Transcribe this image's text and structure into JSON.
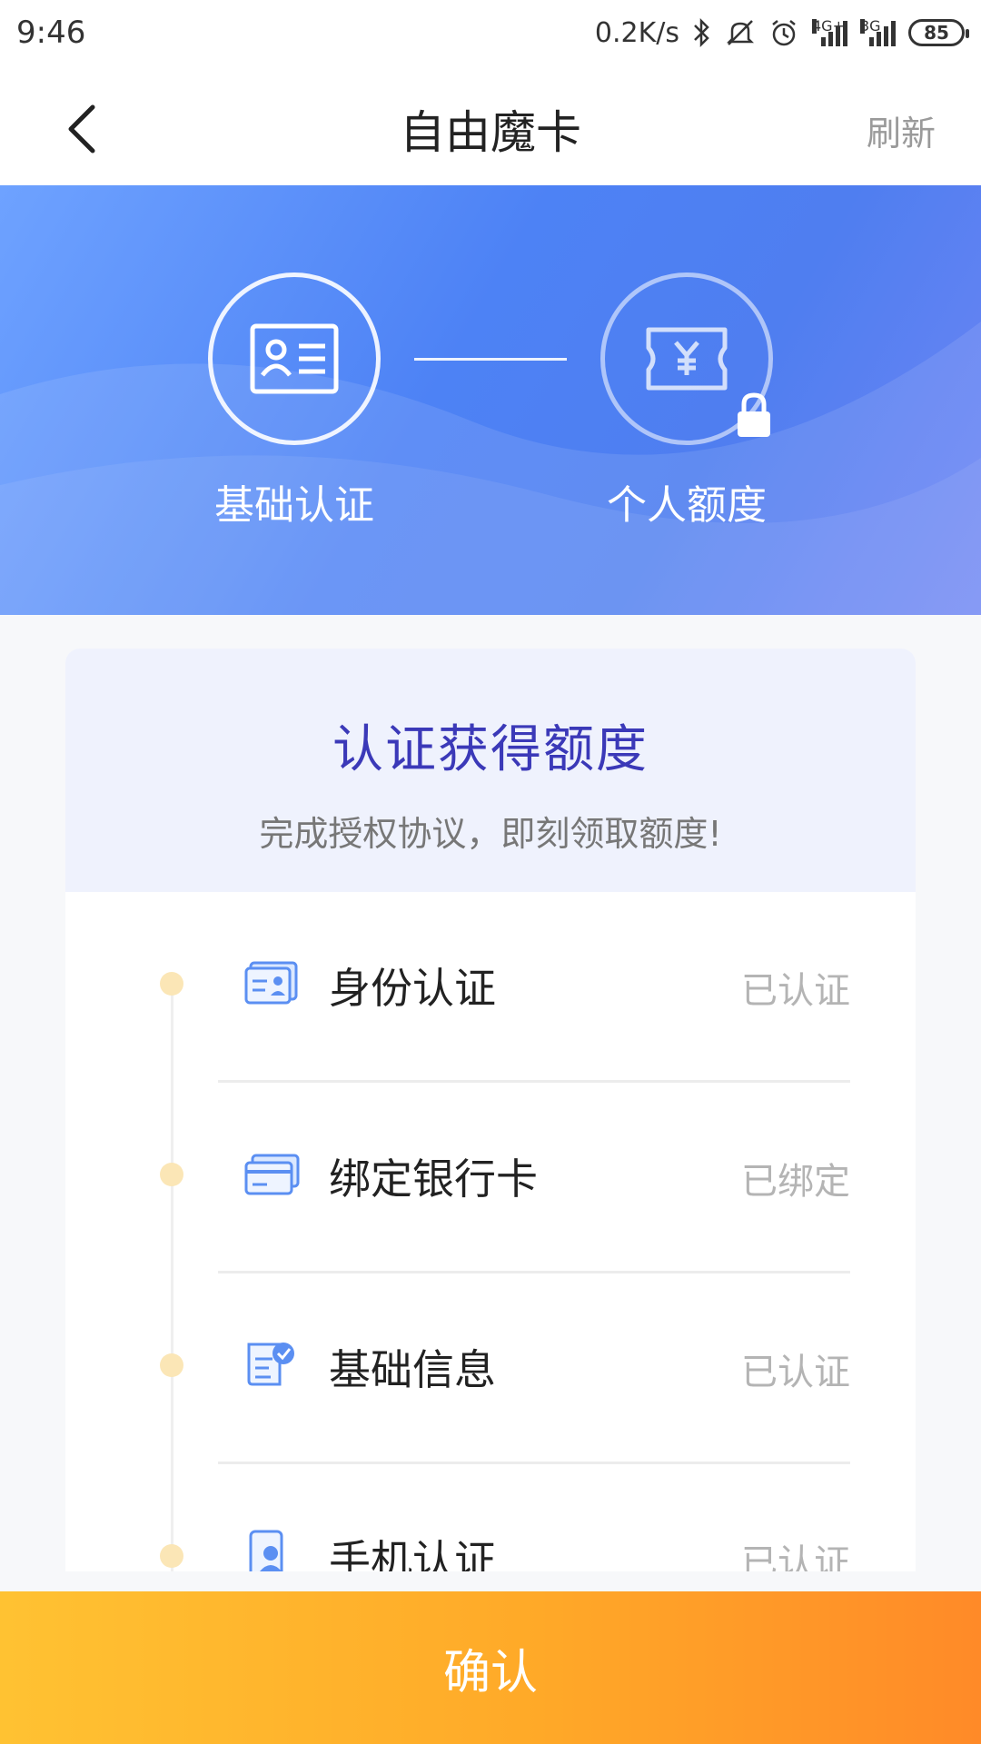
{
  "status_bar": {
    "time": "9:46",
    "net_speed": "0.2K/s",
    "sig1_label": "4G+",
    "sig2_label": "3G",
    "battery": "85"
  },
  "nav": {
    "title": "自由魔卡",
    "refresh_label": "刷新"
  },
  "hero": {
    "steps": [
      {
        "label": "基础认证",
        "icon": "id-card-icon",
        "locked": false
      },
      {
        "label": "个人额度",
        "icon": "yuan-ticket-icon",
        "locked": true
      }
    ]
  },
  "card": {
    "title": "认证获得额度",
    "subtitle": "完成授权协议，即刻领取额度!",
    "items": [
      {
        "name": "身份认证",
        "state": "已认证",
        "icon": "id-card-icon"
      },
      {
        "name": "绑定银行卡",
        "state": "已绑定",
        "icon": "bank-card-icon"
      },
      {
        "name": "基础信息",
        "state": "已认证",
        "icon": "document-check-icon"
      },
      {
        "name": "手机认证",
        "state": "已认证",
        "icon": "phone-user-icon"
      }
    ]
  },
  "confirm_label": "确认",
  "colors": {
    "hero_blue": "#4d82f5",
    "title_indigo": "#3b39b8",
    "confirm_orange": "#ffa928",
    "dot_yellow": "#fbe6b6"
  }
}
